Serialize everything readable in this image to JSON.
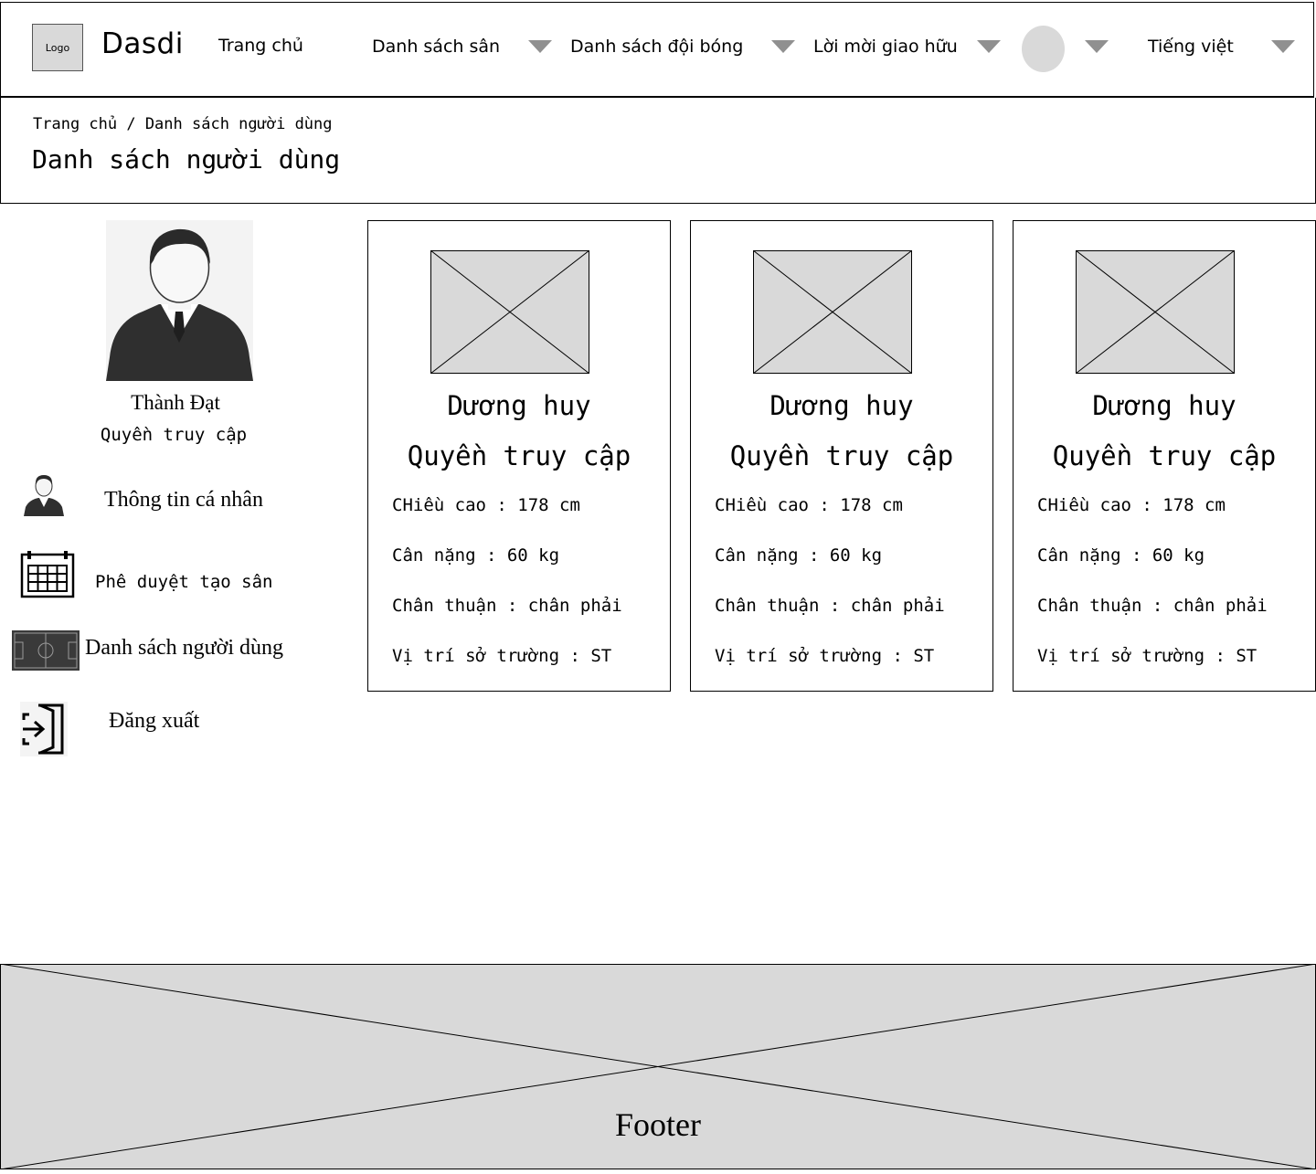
{
  "header": {
    "logo": "Logo",
    "brand": "Dasdi",
    "nav": {
      "home": "Trang chủ",
      "fields": "Danh sách sân",
      "teams": "Danh sách đội bóng",
      "invites": "Lời mời giao hữu",
      "language": "Tiếng việt"
    }
  },
  "page": {
    "breadcrumb": "Trang chủ / Danh sách người dùng",
    "title": "Danh sách người dùng"
  },
  "sidebar": {
    "profile": {
      "name": "Thành Đạt",
      "role": "Quyền truy cập"
    },
    "items": [
      {
        "label": "Thông tin cá nhân",
        "icon": "user-icon"
      },
      {
        "label": "Phê duyệt tạo sân",
        "icon": "calendar-icon"
      },
      {
        "label": "Danh sách người dùng",
        "icon": "soccer-field-icon"
      },
      {
        "label": "Đăng xuất",
        "icon": "logout-icon"
      }
    ]
  },
  "cards": [
    {
      "name": "Dương huy",
      "role": "Quyền truy cập",
      "height": "CHiều cao : 178 cm",
      "weight": "Cân nặng : 60 kg",
      "foot": "Chân thuận : chân phải",
      "position": "Vị trí sở trường : ST"
    },
    {
      "name": "Dương huy",
      "role": "Quyền truy cập",
      "height": "CHiều cao : 178 cm",
      "weight": "Cân nặng : 60 kg",
      "foot": "Chân thuận : chân phải",
      "position": "Vị trí sở trường : ST"
    },
    {
      "name": "Dương huy",
      "role": "Quyền truy cập",
      "height": "CHiều cao : 178 cm",
      "weight": "Cân nặng : 60 kg",
      "foot": "Chân thuận : chân phải",
      "position": "Vị trí sở trường : ST"
    }
  ],
  "footer": {
    "label": "Footer"
  },
  "colors": {
    "placeholder": "#d9d9d9",
    "caret": "#909090",
    "border": "#000000"
  }
}
